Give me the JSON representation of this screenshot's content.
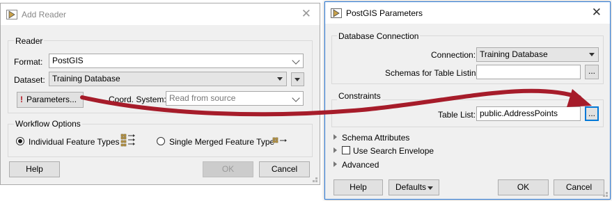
{
  "add_reader": {
    "title": "Add Reader",
    "reader_group": "Reader",
    "format_label": "Format:",
    "format_value": "PostGIS",
    "dataset_label": "Dataset:",
    "dataset_value": "Training Database",
    "parameters_button": "Parameters...",
    "coord_label": "Coord. System:",
    "coord_placeholder": "Read from source",
    "workflow_group": "Workflow Options",
    "option_individual": "Individual Feature Types",
    "option_single": "Single Merged Feature Type",
    "option_individual_selected": true,
    "help_button": "Help",
    "ok_button": "OK",
    "cancel_button": "Cancel"
  },
  "postgis": {
    "title": "PostGIS Parameters",
    "db_group": "Database Connection",
    "connection_label": "Connection:",
    "connection_value": "Training Database",
    "schemas_label": "Schemas for Table Listing:",
    "schemas_value": "",
    "browse_label": "...",
    "constraints_group": "Constraints",
    "table_list_label": "Table List:",
    "table_list_value": "public.AddressPoints",
    "schema_attributes": "Schema Attributes",
    "use_search_envelope": "Use Search Envelope",
    "use_search_envelope_checked": false,
    "advanced": "Advanced",
    "help_button": "Help",
    "defaults_button": "Defaults",
    "ok_button": "OK",
    "cancel_button": "Cancel"
  },
  "colors": {
    "arrow": "#a61c2a",
    "focus": "#0078d7",
    "window_bg": "#f0f0f0"
  },
  "icons": [
    "fme-app-icon",
    "close-icon",
    "exclamation-icon",
    "feature-types-icon",
    "merged-type-icon",
    "dropdown-caret-icon",
    "expander-icon",
    "callout-arrow"
  ]
}
